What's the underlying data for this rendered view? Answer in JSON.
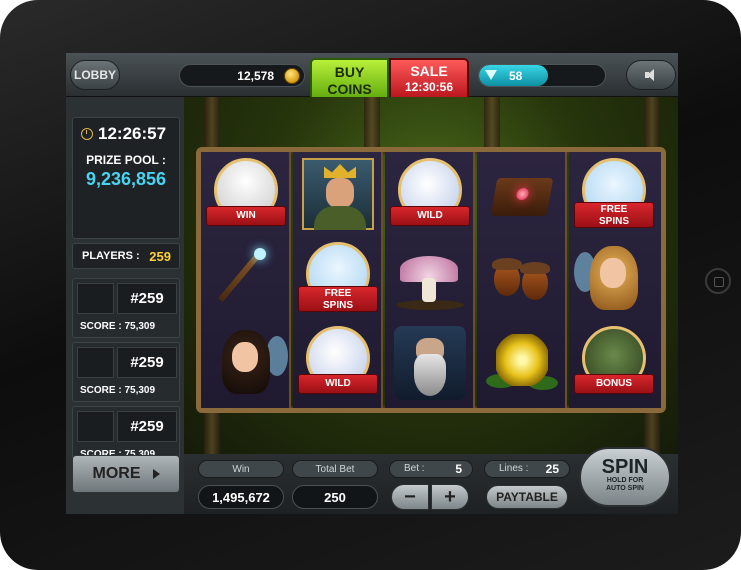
{
  "topbar": {
    "lobby_label": "LOBBY",
    "coins": "12,578",
    "buy_line1": "BUY",
    "buy_line2": "COINS",
    "sale_label": "SALE",
    "sale_timer": "12:30:56",
    "gems": "58",
    "gems_fill_percent": 55
  },
  "left": {
    "timer": "12:26:57",
    "prize_pool_label": "PRIZE POOL :",
    "prize_pool_value": "9,236,856",
    "players_label": "PLAYERS :",
    "players_value": "259",
    "ranks": [
      {
        "rank": "#259",
        "score": "SCORE : 75,309"
      },
      {
        "rank": "#259",
        "score": "SCORE : 75,309"
      },
      {
        "rank": "#259",
        "score": "SCORE : 75,309"
      }
    ],
    "more_label": "MORE"
  },
  "reels": {
    "ribbons": {
      "win": "WIN",
      "wild": "WILD",
      "free1": "FREE",
      "free2": "SPINS",
      "bonus": "BONUS"
    }
  },
  "bottom": {
    "win_label": "Win",
    "win_value": "1,495,672",
    "total_bet_label": "Total Bet",
    "total_bet_value": "250",
    "bet_label": "Bet :",
    "bet_value": "5",
    "lines_label": "Lines :",
    "lines_value": "25",
    "minus": "−",
    "plus": "+",
    "paytable": "PAYTABLE",
    "spin": "SPIN",
    "spin_sub1": "HOLD FOR",
    "spin_sub2": "AUTO SPIN"
  },
  "colors": {
    "prize_pool": "#48d3f0",
    "players_value": "#ffcf3a",
    "buy_green": "#7cc81a",
    "sale_red": "#d41f26",
    "gems_teal": "#1fb6c8"
  }
}
